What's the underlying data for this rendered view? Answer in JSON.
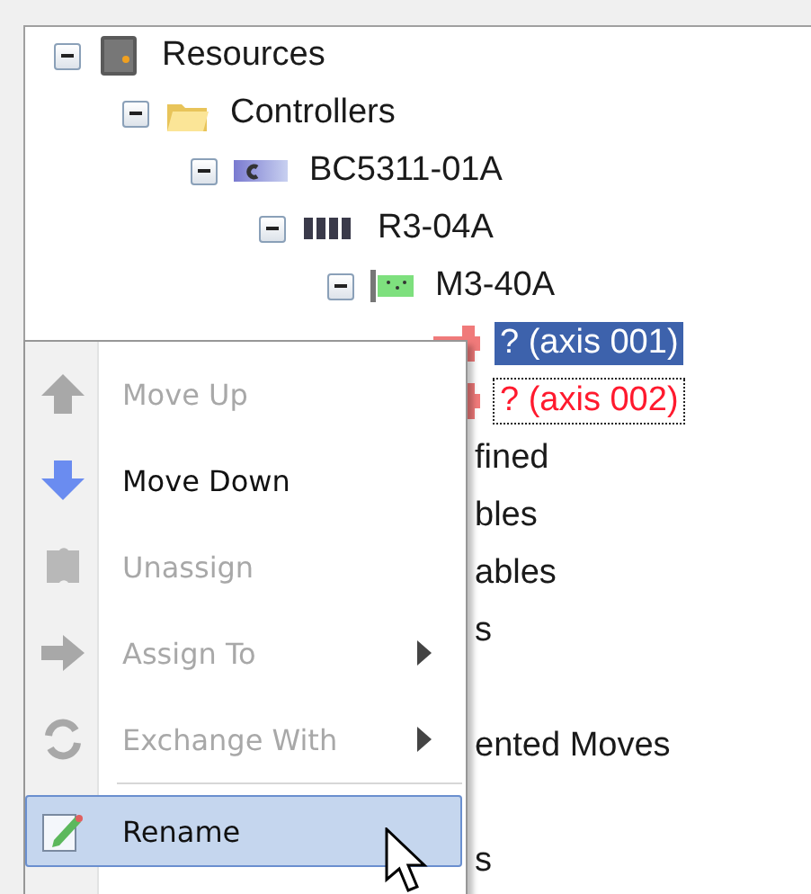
{
  "tree": [
    {
      "label": "Resources",
      "kind": "cabinet",
      "expanded": true,
      "selected": false,
      "error": false,
      "focused": false,
      "children": [
        {
          "label": "Controllers",
          "kind": "folder",
          "expanded": true,
          "selected": false,
          "error": false,
          "focused": false,
          "children": [
            {
              "label": "BC5311-01A",
              "kind": "controller",
              "expanded": true,
              "selected": false,
              "error": false,
              "focused": false,
              "children": [
                {
                  "label": "R3-04A",
                  "kind": "rack",
                  "expanded": true,
                  "selected": false,
                  "error": false,
                  "focused": false,
                  "children": [
                    {
                      "label": "M3-40A",
                      "kind": "module",
                      "expanded": true,
                      "selected": false,
                      "error": false,
                      "focused": false,
                      "children": [
                        {
                          "label": "? (axis 001)",
                          "kind": "axis",
                          "selected": true,
                          "error": true,
                          "focused": false
                        },
                        {
                          "label": "? (axis 002)",
                          "kind": "axis",
                          "selected": false,
                          "error": true,
                          "focused": true
                        }
                      ]
                    }
                  ]
                }
              ]
            }
          ]
        }
      ]
    }
  ],
  "tree_fragments": [
    {
      "text": "fined",
      "gap_before": false
    },
    {
      "text": "bles",
      "gap_before": false
    },
    {
      "text": "ables",
      "gap_before": false
    },
    {
      "text": "s",
      "gap_before": false
    },
    {
      "text": "ented Moves",
      "gap_before": true
    },
    {
      "text": "s",
      "gap_before": true
    }
  ],
  "context_menu": {
    "items": [
      {
        "label": "Move Up",
        "kind": "up",
        "disabled": true,
        "submenu": false,
        "selected": false
      },
      {
        "label": "Move Down",
        "kind": "down",
        "disabled": false,
        "submenu": false,
        "selected": false
      },
      {
        "label": "Unassign",
        "kind": "unassign",
        "disabled": true,
        "submenu": false,
        "selected": false
      },
      {
        "label": "Assign To",
        "kind": "assign",
        "disabled": true,
        "submenu": true,
        "selected": false
      },
      {
        "label": "Exchange With",
        "kind": "exchange",
        "disabled": true,
        "submenu": true,
        "selected": false
      },
      {
        "kind": "separator"
      },
      {
        "label": "Rename",
        "kind": "rename",
        "disabled": false,
        "submenu": false,
        "selected": true
      }
    ]
  }
}
